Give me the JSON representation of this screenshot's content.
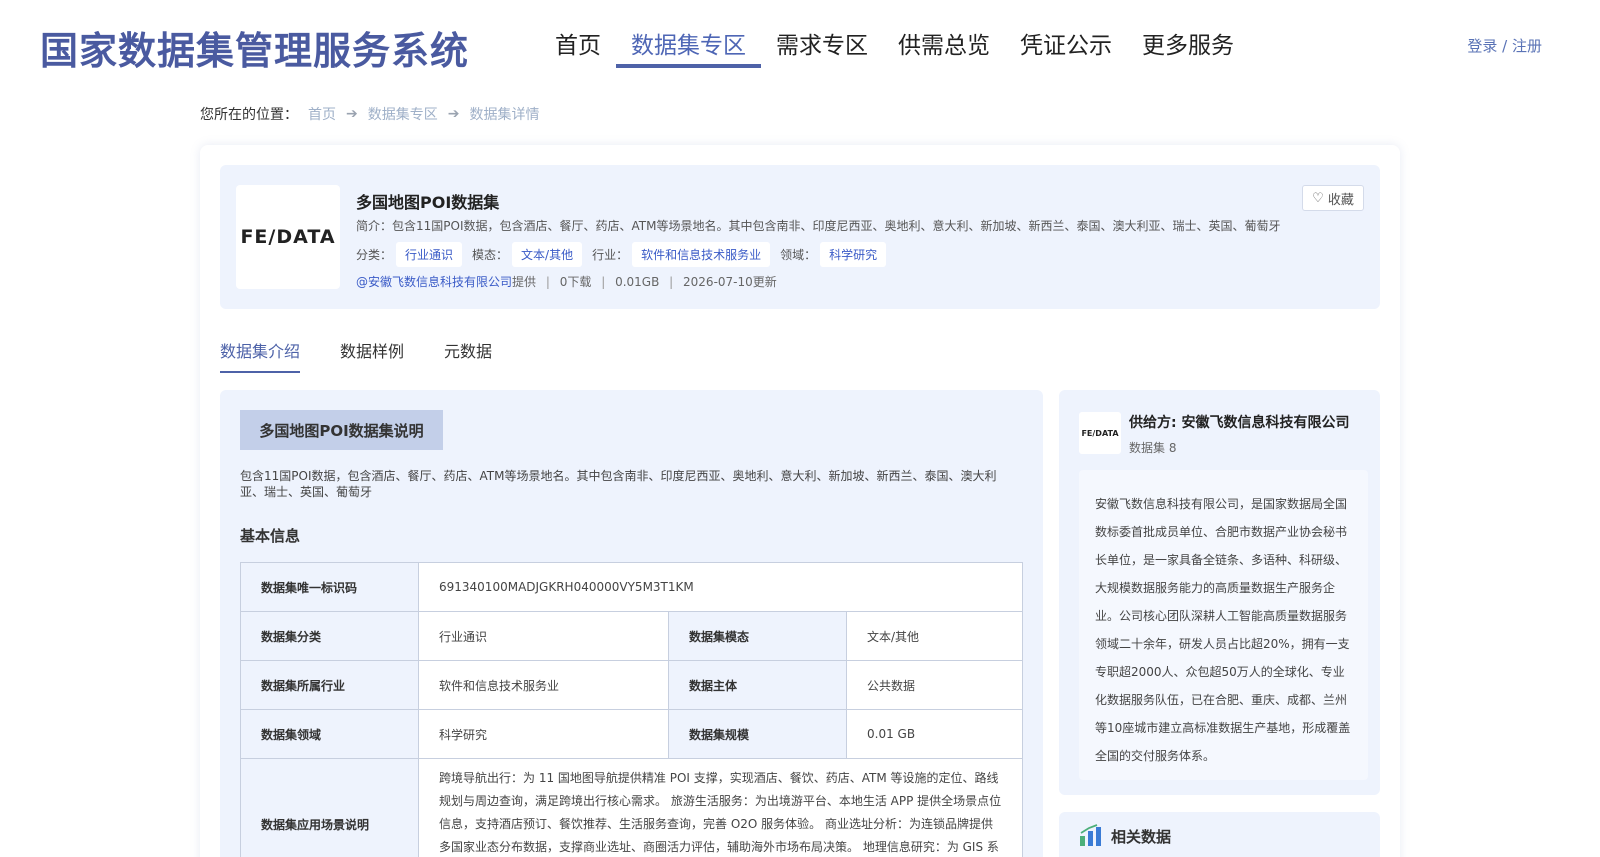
{
  "header": {
    "site_title": "国家数据集管理服务系统",
    "nav": [
      "首页",
      "数据集专区",
      "需求专区",
      "供需总览",
      "凭证公示",
      "更多服务"
    ],
    "nav_active": 1,
    "login": "登录 / 注册"
  },
  "breadcrumb": {
    "label": "您所在的位置：",
    "items": [
      "首页",
      "数据集专区",
      "数据集详情"
    ]
  },
  "dataset": {
    "logo_text": "FE/DATA",
    "title": "多国地图POI数据集",
    "intro": "简介：包含11国POI数据，包含酒店、餐厅、药店、ATM等场景地名。其中包含南非、印度尼西亚、奥地利、意大利、新加坡、新西兰、泰国、澳大利亚、瑞士、英国、葡萄牙",
    "tags": [
      {
        "label": "分类：",
        "value": "行业通识"
      },
      {
        "label": "模态：",
        "value": "文本/其他"
      },
      {
        "label": "行业：",
        "value": "软件和信息技术服务业"
      },
      {
        "label": "领域：",
        "value": "科学研究"
      }
    ],
    "provider": "@安徽飞数信息科技有限公司",
    "provider_suffix": "提供",
    "downloads": "0下载",
    "size": "0.01GB",
    "updated": "2026-07-10更新",
    "favorite_label": "收藏"
  },
  "tabs": [
    "数据集介绍",
    "数据样例",
    "元数据"
  ],
  "tab_active": 0,
  "content": {
    "section_title": "多国地图POI数据集说明",
    "description": "包含11国POI数据，包含酒店、餐厅、药店、ATM等场景地名。其中包含南非、印度尼西亚、奥地利、意大利、新加坡、新西兰、泰国、澳大利亚、瑞士、英国、葡萄牙",
    "basic_info_title": "基本信息",
    "table": {
      "id_label": "数据集唯一标识码",
      "id_value": "691340100MADJGKRH040000VY5M3T1KM",
      "category_label": "数据集分类",
      "category_value": "行业通识",
      "modality_label": "数据集模态",
      "modality_value": "文本/其他",
      "industry_label": "数据集所属行业",
      "industry_value": "软件和信息技术服务业",
      "subject_label": "数据主体",
      "subject_value": "公共数据",
      "domain_label": "数据集领域",
      "domain_value": "科学研究",
      "scale_label": "数据集规模",
      "scale_value": "0.01 GB",
      "scene_label": "数据集应用场景说明",
      "scene_value": "跨境导航出行：为 11 国地图导航提供精准 POI 支撑，实现酒店、餐饮、药店、ATM 等设施的定位、路线规划与周边查询，满足跨境出行核心需求。 旅游生活服务：为出境游平台、本地生活 APP 提供全场景点位信息，支持酒店预订、餐饮推荐、生活服务查询，完善 O2O 服务体验。 商业选址分析：为连锁品牌提供多国家业态分布数据，支撑商业选址、商圈活力评估，辅助海外市场布局决策。 地理信息研究：为 GIS 系统、城市"
    }
  },
  "supplier": {
    "logo_text": "FE/DATA",
    "name": "供给方: 安徽飞数信息科技有限公司",
    "count": "数据集 8",
    "description": "安徽飞数信息科技有限公司，是国家数据局全国数标委首批成员单位、合肥市数据产业协会秘书长单位，是一家具备全链条、多语种、科研级、大规模数据服务能力的高质量数据生产服务企业。公司核心团队深耕人工智能高质量数据服务领域二十余年，研发人员占比超20%，拥有一支专职超2000人、众包超50万人的全球化、专业化数据服务队伍，已在合肥、重庆、成都、兰州等10座城市建立高标准数据生产基地，形成覆盖全国的交付服务体系。"
  },
  "related": {
    "title": "相关数据",
    "icon": "bar-chart-icon"
  },
  "colors": {
    "brand": "#4a5aa0",
    "accent": "#3a5bc7",
    "panel_bg": "#eef3fd"
  }
}
